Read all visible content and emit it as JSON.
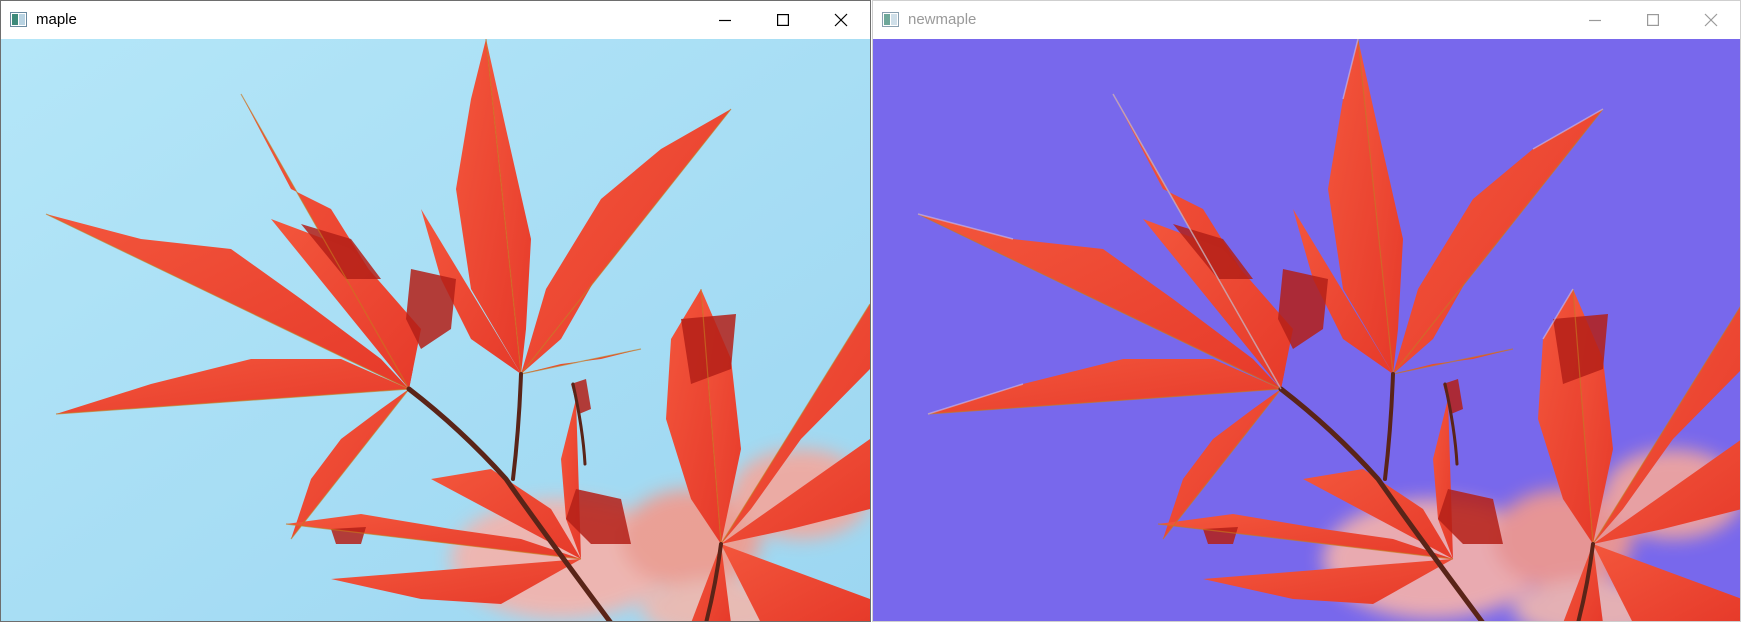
{
  "windows": [
    {
      "title": "maple",
      "state": "active",
      "controls": [
        "minimize-icon",
        "maximize-icon",
        "close-icon"
      ],
      "image": "maple-leaves-photo",
      "background_color": "#a9def4"
    },
    {
      "title": "newmaple",
      "state": "inactive",
      "controls": [
        "minimize-icon",
        "maximize-icon",
        "close-icon"
      ],
      "image": "maple-leaves-recolored",
      "background_color": "#7868ec"
    }
  ],
  "colors": {
    "leaf": "#ef4a34",
    "leaf_shadow": "#b02018",
    "stem": "#5a2418",
    "sky": "#a9def4",
    "replaced_background": "#7868ec"
  }
}
